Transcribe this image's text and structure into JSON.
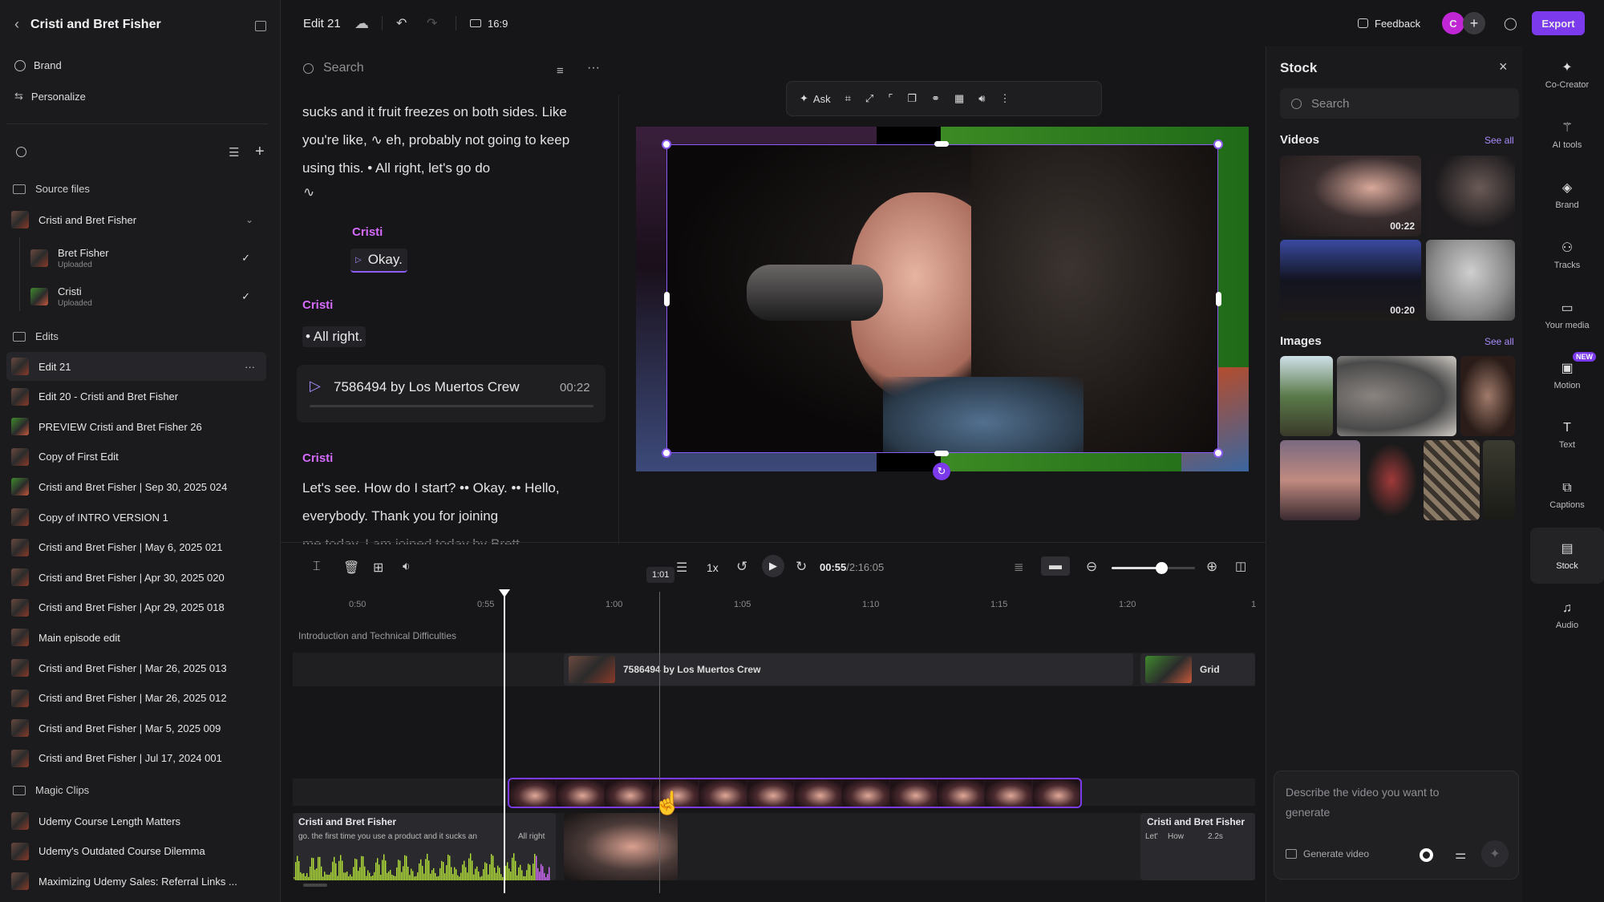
{
  "left_panel": {
    "project_title": "Cristi and Bret Fisher",
    "nav": [
      {
        "label": "Brand"
      },
      {
        "label": "Personalize"
      }
    ],
    "source_files_label": "Source files",
    "source_group": {
      "label": "Cristi and Bret Fisher",
      "children": [
        {
          "name": "Bret Fisher",
          "status": "Uploaded"
        },
        {
          "name": "Cristi",
          "status": "Uploaded"
        }
      ]
    },
    "edits_label": "Edits",
    "edits": [
      "Edit 21",
      "Edit 20 - Cristi and Bret Fisher",
      "PREVIEW Cristi and Bret Fisher 26",
      "Copy of First Edit",
      "Cristi and Bret Fisher | Sep 30, 2025 024",
      "Copy of INTRO VERSION 1",
      "Cristi and Bret Fisher | May 6, 2025 021",
      "Cristi and Bret Fisher | Apr 30, 2025 020",
      "Cristi and Bret Fisher | Apr 29, 2025 018",
      "Main episode edit",
      "Cristi and Bret Fisher | Mar 26, 2025 013",
      "Cristi and Bret Fisher | Mar 26, 2025 012",
      "Cristi and Bret Fisher | Mar 5, 2025 009",
      "Cristi and Bret Fisher | Jul 17, 2024 001"
    ],
    "magic_clips_label": "Magic Clips",
    "magic_clips": [
      "Udemy Course Length Matters",
      "Udemy's Outdated Course Dilemma",
      "Maximizing Udemy Sales: Referral Links ..."
    ]
  },
  "topbar": {
    "edit_name": "Edit 21",
    "aspect": "16:9",
    "feedback": "Feedback",
    "avatar_initial": "C",
    "export": "Export"
  },
  "transcript": {
    "search_placeholder": "Search",
    "p1": "sucks and it fruit freezes on both sides. Like you're like, ∿ eh, probably not going to keep using this. • All right, let's go do",
    "wave": "∿",
    "speaker1": "Cristi",
    "okay": "Okay.",
    "speaker2": "Cristi",
    "allright": "• All right.",
    "clip_title": "7586494 by Los Muertos Crew",
    "clip_duration": "00:22",
    "speaker3": "Cristi",
    "p2": "Let's see. How do I start? •• Okay. •• Hello, everybody. Thank you for joining",
    "p3": "me today. I am joined today by Brett"
  },
  "viewer_toolbar": {
    "ask": "Ask"
  },
  "timeline": {
    "time_current": "00:55",
    "time_total": "/2:16:05",
    "speed": "1x",
    "hover_time": "1:01",
    "ruler": [
      "0:50",
      "0:55",
      "1:00",
      "1:05",
      "1:10",
      "1:15",
      "1:20",
      "1"
    ],
    "chapter": "Introduction and Technical Difficulties",
    "clip_stock": "7586494 by Los Muertos Crew",
    "clip_grid": "Grid",
    "track_a_label": "Cristi and Bret Fisher",
    "track_a_words": "go.  the first time you use a product and it sucks an",
    "track_a_words2": "All right",
    "track_b_label": "Cristi and Bret Fisher",
    "track_b_w1": "Let'",
    "track_b_w2": "How",
    "track_b_w3": "2.2s",
    "zoom_level": 0.6
  },
  "stock": {
    "title": "Stock",
    "search_placeholder": "Search",
    "videos_label": "Videos",
    "see_all": "See all",
    "video_durations": [
      "00:22",
      "00:20"
    ],
    "images_label": "Images",
    "see_all_images": "See all",
    "prompt_placeholder": "Describe the video you want to generate",
    "generate": "Generate video"
  },
  "rail": [
    {
      "label": "Co-Creator",
      "icon": "sparkle-icon"
    },
    {
      "label": "AI tools",
      "icon": "magic-wand-icon"
    },
    {
      "label": "Brand",
      "icon": "brand-icon"
    },
    {
      "label": "Tracks",
      "icon": "tracks-icon"
    },
    {
      "label": "Your media",
      "icon": "folder-icon"
    },
    {
      "label": "Motion",
      "icon": "motion-icon",
      "badge": "NEW"
    },
    {
      "label": "Text",
      "icon": "text-icon"
    },
    {
      "label": "Captions",
      "icon": "captions-icon"
    },
    {
      "label": "Stock",
      "icon": "stock-icon"
    },
    {
      "label": "Audio",
      "icon": "music-icon"
    }
  ],
  "colors": {
    "accent": "#7c3aed",
    "speaker": "#d56bff",
    "export": "#7c3aed",
    "wave": "#b6e33a"
  }
}
